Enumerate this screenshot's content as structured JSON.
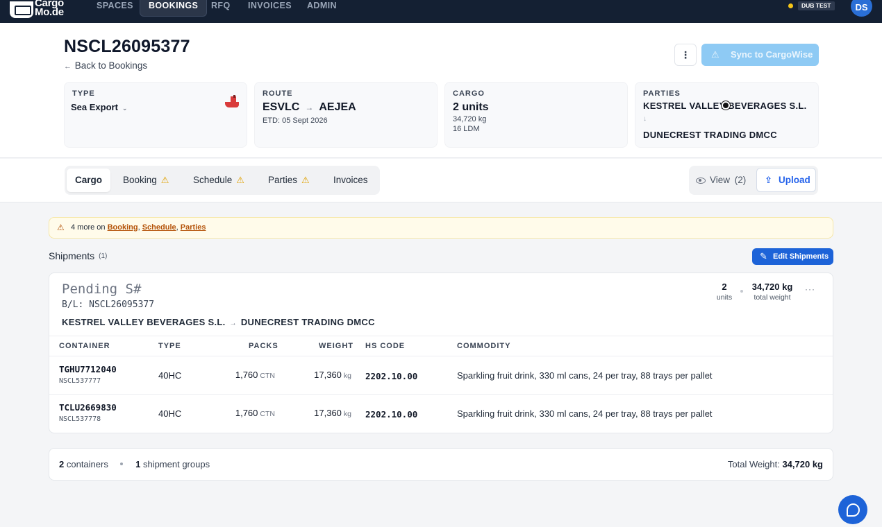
{
  "nav": {
    "logo_line1": "Cargo",
    "logo_line2": "Mo.de",
    "items": [
      "SPACES",
      "BOOKINGS",
      "RFQ",
      "INVOICES",
      "ADMIN"
    ],
    "active": "BOOKINGS",
    "env_badge": "DUB TEST",
    "avatar": "DS"
  },
  "header": {
    "title": "NSCL26095377",
    "back_link": "Back to Bookings",
    "more_icon": "⋮",
    "sync_button": "Sync to CargoWise",
    "type": {
      "label": "TYPE",
      "value": "Sea Export"
    },
    "route": {
      "label": "ROUTE",
      "origin": "ESVLC",
      "destination": "AEJEA",
      "etd": "ETD: 05 Sept 2026"
    },
    "cargo": {
      "label": "CARGO",
      "units": "2 units",
      "weight": "34,720 kg",
      "ldm": "16 LDM"
    },
    "parties": {
      "label": "PARTIES",
      "from": "KESTREL VALLEY BEVERAGES S.L.",
      "to": "DUNECREST TRADING DMCC"
    }
  },
  "tabs": {
    "items": [
      "Cargo",
      "Booking",
      "Schedule",
      "Parties",
      "Invoices"
    ],
    "active": "Cargo",
    "view_label": "View",
    "view_count": "(2)",
    "upload_label": "Upload"
  },
  "alert": {
    "prefix": "4 more on",
    "links": [
      "Booking",
      "Schedule",
      "Parties"
    ]
  },
  "shipments": {
    "heading": "Shipments",
    "count": "(1)",
    "edit_button": "Edit Shipments",
    "card": {
      "title": "Pending S#",
      "bl": "B/L: NSCL26095377",
      "from": "KESTREL VALLEY BEVERAGES S.L.",
      "to": "DUNECREST TRADING DMCC",
      "units_value": "2",
      "units_label": "units",
      "weight_value": "34,720 kg",
      "weight_label": "total weight",
      "more": "···"
    },
    "columns": [
      "CONTAINER",
      "TYPE",
      "PACKS",
      "WEIGHT",
      "HS CODE",
      "COMMODITY"
    ],
    "rows": [
      {
        "container": "TGHU7712040",
        "ref": "NSCL537777",
        "type": "40HC",
        "packs": "1,760",
        "packs_unit": "CTN",
        "weight": "17,360",
        "weight_unit": "kg",
        "hs": "2202.10.00",
        "commodity": "Sparkling fruit drink, 330 ml cans, 24 per tray, 88 trays per pallet"
      },
      {
        "container": "TCLU2669830",
        "ref": "NSCL537778",
        "type": "40HC",
        "packs": "1,760",
        "packs_unit": "CTN",
        "weight": "17,360",
        "weight_unit": "kg",
        "hs": "2202.10.00",
        "commodity": "Sparkling fruit drink, 330 ml cans, 24 per tray, 88 trays per pallet"
      }
    ]
  },
  "footer": {
    "containers_count": "2",
    "containers_label": "containers",
    "groups_count": "1",
    "groups_label": "shipment groups",
    "total_label": "Total Weight:",
    "total_value": "34,720 kg"
  }
}
